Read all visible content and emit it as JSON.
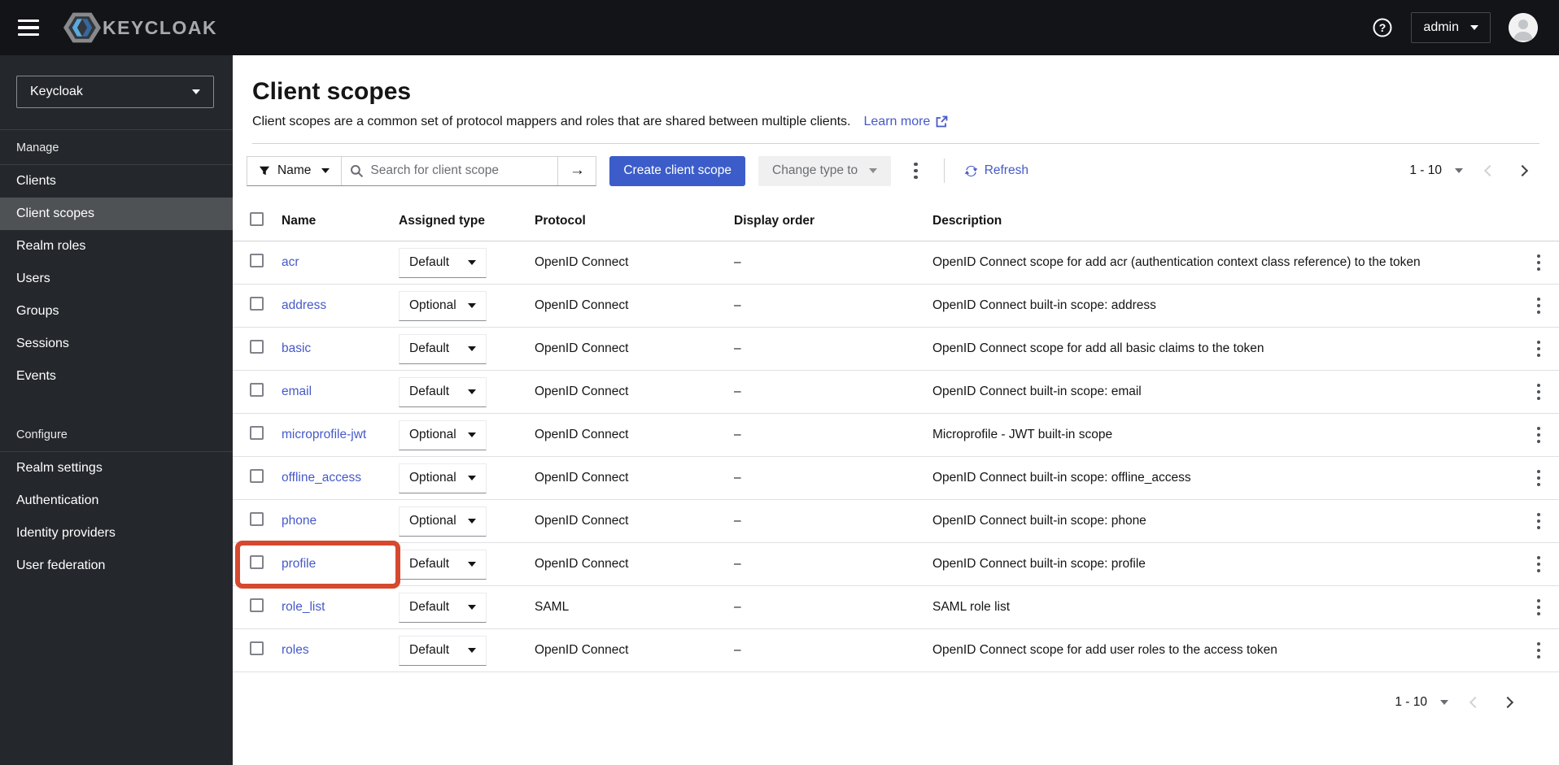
{
  "masthead": {
    "brand": "KEYCLOAK",
    "user_menu_label": "admin"
  },
  "icons": {
    "help_glyph": "?"
  },
  "sidebar": {
    "realm_selector": "Keycloak",
    "groups": [
      {
        "label": "Manage",
        "items": [
          {
            "label": "Clients"
          },
          {
            "label": "Client scopes",
            "active": true
          },
          {
            "label": "Realm roles"
          },
          {
            "label": "Users"
          },
          {
            "label": "Groups"
          },
          {
            "label": "Sessions"
          },
          {
            "label": "Events"
          }
        ]
      },
      {
        "label": "Configure",
        "items": [
          {
            "label": "Realm settings"
          },
          {
            "label": "Authentication"
          },
          {
            "label": "Identity providers"
          },
          {
            "label": "User federation"
          }
        ]
      }
    ]
  },
  "page": {
    "title": "Client scopes",
    "description": "Client scopes are a common set of protocol mappers and roles that are shared between multiple clients.",
    "learn_more_label": "Learn more"
  },
  "toolbar": {
    "filter_label": "Name",
    "search_placeholder": "Search for client scope",
    "create_button_label": "Create client scope",
    "change_type_label": "Change type to",
    "refresh_label": "Refresh",
    "pagination_label": "1 - 10"
  },
  "table": {
    "headers": [
      "Name",
      "Assigned type",
      "Protocol",
      "Display order",
      "Description"
    ],
    "rows": [
      {
        "name": "acr",
        "type": "Default",
        "protocol": "OpenID Connect",
        "display_order": "–",
        "description": "OpenID Connect scope for add acr (authentication context class reference) to the token"
      },
      {
        "name": "address",
        "type": "Optional",
        "protocol": "OpenID Connect",
        "display_order": "–",
        "description": "OpenID Connect built-in scope: address"
      },
      {
        "name": "basic",
        "type": "Default",
        "protocol": "OpenID Connect",
        "display_order": "–",
        "description": "OpenID Connect scope for add all basic claims to the token"
      },
      {
        "name": "email",
        "type": "Default",
        "protocol": "OpenID Connect",
        "display_order": "–",
        "description": "OpenID Connect built-in scope: email"
      },
      {
        "name": "microprofile-jwt",
        "type": "Optional",
        "protocol": "OpenID Connect",
        "display_order": "–",
        "description": "Microprofile - JWT built-in scope"
      },
      {
        "name": "offline_access",
        "type": "Optional",
        "protocol": "OpenID Connect",
        "display_order": "–",
        "description": "OpenID Connect built-in scope: offline_access"
      },
      {
        "name": "phone",
        "type": "Optional",
        "protocol": "OpenID Connect",
        "display_order": "–",
        "description": "OpenID Connect built-in scope: phone"
      },
      {
        "name": "profile",
        "type": "Default",
        "protocol": "OpenID Connect",
        "display_order": "–",
        "description": "OpenID Connect built-in scope: profile",
        "highlighted": true
      },
      {
        "name": "role_list",
        "type": "Default",
        "protocol": "SAML",
        "display_order": "–",
        "description": "SAML role list"
      },
      {
        "name": "roles",
        "type": "Default",
        "protocol": "OpenID Connect",
        "display_order": "–",
        "description": "OpenID Connect scope for add user roles to the access token"
      }
    ],
    "pagination_label": "1 - 10"
  },
  "colors": {
    "masthead_bg": "#121417",
    "sidebar_bg": "#24272b",
    "active_item_bg": "#4f5255",
    "annotation_red": "#d6492f",
    "primary_button_blue": "#3b5cc9",
    "link_blue": "#4659c8",
    "disabled_bg": "#f0f0f0"
  }
}
